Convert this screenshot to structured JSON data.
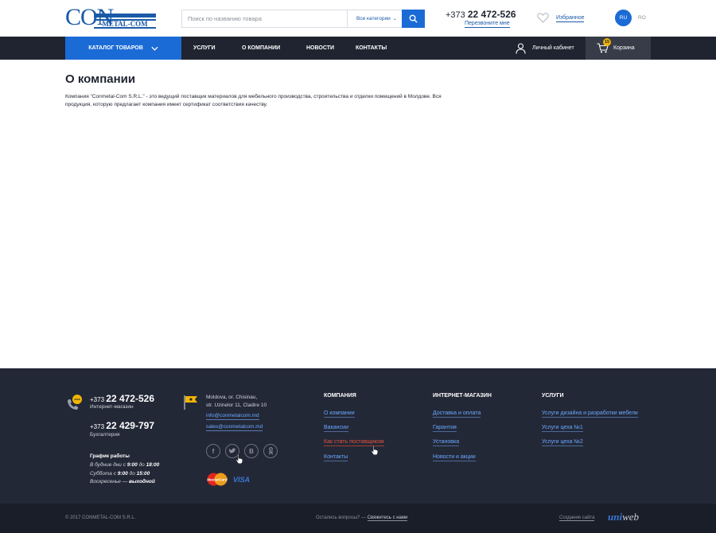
{
  "header": {
    "logo_top": "CON",
    "logo_bottom": "METAL-COM",
    "search_placeholder": "Поиск по названию товара",
    "search_category": "Все категории",
    "phone_prefix": "+373",
    "phone_number": "22 472-526",
    "callback": "Перезвоните мне",
    "favorites": "Избранное",
    "lang_active": "RU",
    "lang_other": "RO"
  },
  "nav": {
    "catalog": "КАТАЛОГ ТОВАРОВ",
    "items": [
      "УСЛУГИ",
      "О КОМПАНИИ",
      "НОВОСТИ",
      "КОНТАКТЫ"
    ],
    "cabinet": "Личный кабинет",
    "cart": "Корзина",
    "cart_count": "15"
  },
  "main": {
    "title": "О компании",
    "text": "Компания \"Conmetal-Com S.R.L.\" - это ведущий поставщик материалов для мебельного производства, строительства и отделки помещений в Молдове. Вся продукция, которую предлагает компания имеет сертификат соответствия качеству."
  },
  "footer": {
    "phone1_prefix": "+373",
    "phone1": "22 472-526",
    "phone1_label": "Интернет-магазин",
    "phone2_prefix": "+373",
    "phone2": "22 429-797",
    "phone2_label": "Бухгалтерия",
    "schedule_title": "График работы",
    "schedule": {
      "weekdays_pre": "В будние дни с",
      "weekdays_from": "9:00",
      "weekdays_mid": "до",
      "weekdays_to": "18:00",
      "saturday_pre": "Суббота с",
      "saturday_from": "9:00",
      "saturday_mid": "до",
      "saturday_to": "15:00",
      "sunday_pre": "Воскресенье —",
      "sunday_val": "выходной"
    },
    "address_line1": "Moldova, or. Chisinau,",
    "address_line2": "str. Uzinelor 11, Cladire 10",
    "email1": "info@conmetalcom.md",
    "email2": "sales@conmetalcom.md",
    "social_icons": [
      "facebook-icon",
      "twitter-icon",
      "vk-icon",
      "odnoklassniki-icon"
    ],
    "mastercard": "MasterCard",
    "visa": "VISA",
    "col_company": {
      "title": "КОМПАНИЯ",
      "links": [
        "О компании",
        "Вакансии",
        "Как стать поставщиком",
        "Контакты"
      ]
    },
    "col_shop": {
      "title": "ИНТЕРНЕТ-МАГАЗИН",
      "links": [
        "Доставка и оплата",
        "Гарантия",
        "Установка",
        "Новости и акции"
      ]
    },
    "col_services": {
      "title": "УСЛУГИ",
      "links": [
        "Услуги дизайна и разработки мебели",
        "Услуги цеха №1",
        "Услуги цеха №2"
      ]
    }
  },
  "bottom": {
    "copyright": "© 2017 CONMETAL-COM S.R.L.",
    "questions": "Остались вопросы? —",
    "contact_us": "Свяжитесь с нами",
    "made_by": "Создание сайта",
    "dev_logo_a": "uni",
    "dev_logo_b": "web"
  },
  "colors": {
    "accent": "#1b6bd6",
    "nav_bg": "#1f2430",
    "footer_bg": "#232837",
    "link": "#6aa8ff",
    "active_link": "#e0513b",
    "badge": "#f2b400"
  }
}
